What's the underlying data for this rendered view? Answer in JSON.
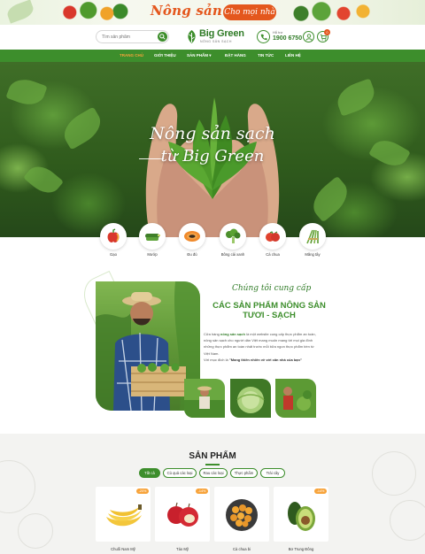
{
  "top_banner": {
    "title": "Nông sản sạch",
    "subtitle": "Cho mọi nhà"
  },
  "header": {
    "search_placeholder": "Tìm sản phẩm",
    "logo_text": "Big Green",
    "logo_tagline": "NÔNG SẢN SẠCH",
    "hotline_label": "Hỗ trợ",
    "hotline_number": "1900 6750",
    "cart_count": "0"
  },
  "nav": {
    "items": [
      {
        "label": "Trang chủ",
        "active": true
      },
      {
        "label": "Giới thiệu",
        "active": false
      },
      {
        "label": "Sản phẩm ▾",
        "active": false
      },
      {
        "label": "Đặt hàng",
        "active": false
      },
      {
        "label": "Tin tức",
        "active": false
      },
      {
        "label": "Liên hệ",
        "active": false
      }
    ]
  },
  "hero": {
    "title": "Nông sản sạch",
    "subtitle": "từ Big Green"
  },
  "categories": [
    {
      "label": "Gạo",
      "icon": "pepper-icon"
    },
    {
      "label": "Mướp",
      "icon": "zucchini-icon"
    },
    {
      "label": "Đu đủ",
      "icon": "papaya-icon"
    },
    {
      "label": "Bông cải xanh",
      "icon": "broccoli-icon"
    },
    {
      "label": "Cà chua",
      "icon": "tomato-icon"
    },
    {
      "label": "Măng tây",
      "icon": "asparagus-icon"
    }
  ],
  "about": {
    "script": "Chúng tôi cung cấp",
    "heading": "CÁC SẢN PHẨM NÔNG SẢN TƯƠI - SẠCH",
    "text_1": "Cửa hàng ",
    "text_brand": "nông sản sạch",
    "text_2": " là một website cung cấp thực phẩm an toàn, nông sản sạch cho người dân Việt mang muốn mang tới mọi gia đình những thực phẩm an toàn nhất trước mỗi bữa ngon thực phẩm bền từ Việt Nam.",
    "text_3": "Với mục đích là ",
    "text_quote": "\"Mang thiên nhiên về với căn nhà của bạn\""
  },
  "products": {
    "title": "SẢN PHẨM",
    "tabs": [
      {
        "label": "Tất cả",
        "active": true
      },
      {
        "label": "Củ quả các loại",
        "active": false
      },
      {
        "label": "Rau các loại",
        "active": false
      },
      {
        "label": "Thực phẩm",
        "active": false
      },
      {
        "label": "Trái cây",
        "active": false
      }
    ],
    "items": [
      {
        "name": "Chuối Nam Mỹ",
        "badge": "-20%"
      },
      {
        "name": "Táo Mỹ",
        "badge": "-14%"
      },
      {
        "name": "Cà chua bi",
        "badge": ""
      },
      {
        "name": "Bơ Trung Đông",
        "badge": "-14%"
      }
    ]
  },
  "colors": {
    "brand_green": "#3d8e2c",
    "accent_orange": "#e4571d",
    "badge_orange": "#f7a33a"
  }
}
